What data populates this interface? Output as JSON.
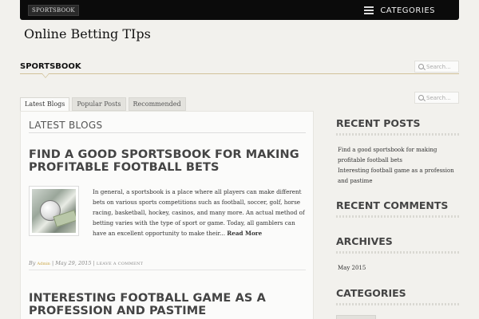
{
  "topbar": {
    "home_link": "SPORTSBOOK",
    "menu_label": "CATEGORIES"
  },
  "site": {
    "title": "Online Betting TIps"
  },
  "section": {
    "heading": "SPORTSBOOK"
  },
  "search": {
    "placeholder": "Search..."
  },
  "tabs": [
    {
      "label": "Latest Blogs",
      "active": true
    },
    {
      "label": "Popular Posts",
      "active": false
    },
    {
      "label": "Recommended",
      "active": false
    }
  ],
  "main": {
    "panel_title": "LATEST BLOGS",
    "posts": [
      {
        "title": "FIND A GOOD SPORTSBOOK FOR MAKING PROFITABLE FOOTBALL BETS",
        "excerpt": "In general, a sportsbook is a place where all players can make different bets on various sports competitions such as football, soccer, golf, horse racing, basketball, hockey, casinos, and many more. An actual method of betting varies with the type of sport or game. Today, all gamblers can have an excellent opportunity to make their...",
        "read_more": "Read More",
        "meta_by": "By",
        "meta_author": "Admin",
        "meta_sep": "|",
        "meta_date": "May 29, 2015",
        "meta_comment": "LEAVE A COMMENT"
      },
      {
        "title": "INTERESTING FOOTBALL GAME AS A PROFESSION AND PASTIME"
      }
    ]
  },
  "sidebar": {
    "recent_posts_title": "RECENT POSTS",
    "recent_posts": [
      "Find a good sportsbook for making profitable football bets",
      "Interesting football game as a profession and pastime"
    ],
    "recent_comments_title": "RECENT COMMENTS",
    "archives_title": "ARCHIVES",
    "archives": [
      "May 2015"
    ],
    "categories_title": "CATEGORIES"
  }
}
